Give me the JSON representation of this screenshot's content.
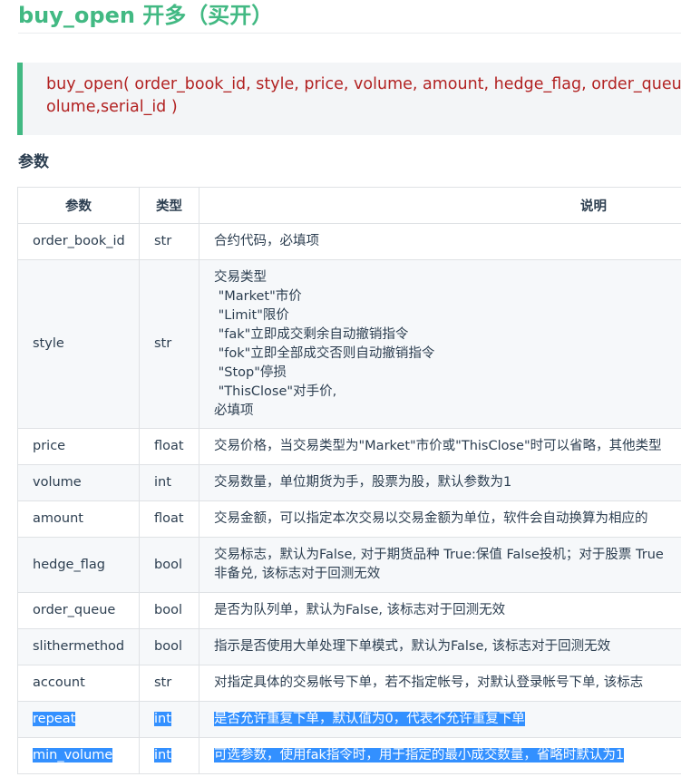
{
  "title": "buy_open 开多（买开）",
  "signature": {
    "line1": "buy_open( order_book_id, style, price, volume, amount, hedge_flag, order_queue, sl",
    "line2": "olume,serial_id )"
  },
  "section_heading": "参数",
  "table": {
    "headers": [
      "参数",
      "类型",
      "说明"
    ],
    "rows": [
      {
        "param": "order_book_id",
        "type": "str",
        "desc": [
          "合约代码，必填项"
        ]
      },
      {
        "param": "style",
        "type": "str",
        "desc": [
          "交易类型",
          " \"Market\"市价",
          " \"Limit\"限价",
          " \"fak\"立即成交剩余自动撤销指令",
          " \"fok\"立即全部成交否则自动撤销指令",
          " \"Stop\"停损",
          " \"ThisClose\"对手价,",
          "必填项"
        ]
      },
      {
        "param": "price",
        "type": "float",
        "desc": [
          "交易价格，当交易类型为\"Market\"市价或\"ThisClose\"时可以省略，其他类型"
        ]
      },
      {
        "param": "volume",
        "type": "int",
        "desc": [
          "交易数量，单位期货为手，股票为股，默认参数为1"
        ]
      },
      {
        "param": "amount",
        "type": "float",
        "desc": [
          "交易金额，可以指定本次交易以交易金额为单位，软件会自动换算为相应的"
        ]
      },
      {
        "param": "hedge_flag",
        "type": "bool",
        "desc": [
          "交易标志，默认为False, 对于期货品种 True:保值 False投机；对于股票 True",
          "非备兑, 该标志对于回测无效"
        ]
      },
      {
        "param": "order_queue",
        "type": "bool",
        "desc": [
          "是否为队列单，默认为False, 该标志对于回测无效"
        ]
      },
      {
        "param": "slithermethod",
        "type": "bool",
        "desc": [
          "指示是否使用大单处理下单模式，默认为False, 该标志对于回测无效"
        ]
      },
      {
        "param": "account",
        "type": "str",
        "desc": [
          "对指定具体的交易帐号下单，若不指定帐号，对默认登录帐号下单, 该标志"
        ]
      },
      {
        "param": "repeat",
        "type": "int",
        "desc": [
          "是否允许重复下单，默认值为0，代表不允许重复下单"
        ],
        "selected": true
      },
      {
        "param": "min_volume",
        "type": "int",
        "desc": [
          "可选参数，使用fak指令时，用于指定的最小成交数量，省略时默认为1"
        ],
        "selected": true
      }
    ]
  },
  "colors": {
    "accent": "#42b983",
    "code": "#b22222",
    "selection": "#3390ff"
  }
}
